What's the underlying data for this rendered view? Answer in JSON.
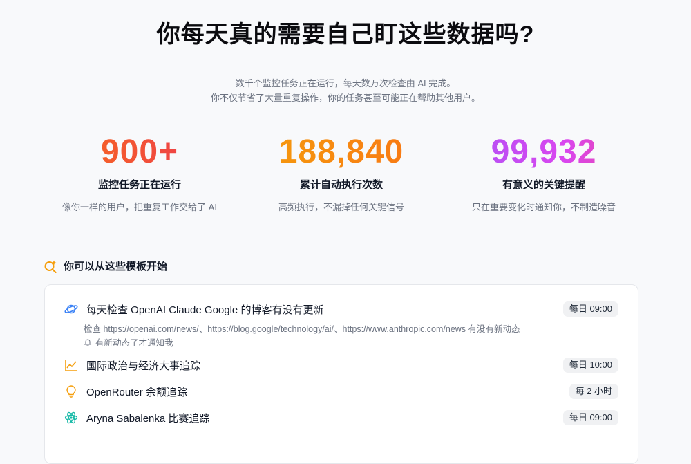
{
  "hero": {
    "title": "你每天真的需要自己盯这些数据吗?",
    "subtitle_line1": "数千个监控任务正在运行，每天数万次检查由 AI 完成。",
    "subtitle_line2": "你不仅节省了大量重复操作，你的任务甚至可能正在帮助其他用户。"
  },
  "stats": [
    {
      "value": "900+",
      "label": "监控任务正在运行",
      "desc": "像你一样的用户，把重复工作交给了 AI"
    },
    {
      "value": "188,840",
      "label": "累计自动执行次数",
      "desc": "高频执行，不漏掉任何关键信号"
    },
    {
      "value": "99,932",
      "label": "有意义的关键提醒",
      "desc": "只在重要变化时通知你，不制造噪音"
    }
  ],
  "templates": {
    "heading": "你可以从这些模板开始",
    "heading_icon": "sparkle-search-icon",
    "items": [
      {
        "title": "每天检查 OpenAI Claude Google 的博客有没有更新",
        "icon": "planet-icon",
        "schedule": "每日 09:00",
        "detail": "检查 https://openai.com/news/、https://blog.google/technology/ai/、https://www.anthropic.com/news 有没有新动态",
        "notify": "有新动态了才通知我",
        "notify_icon": "bell-icon"
      },
      {
        "title": "国际政治与经济大事追踪",
        "icon": "line-chart-icon",
        "schedule": "每日 10:00"
      },
      {
        "title": "OpenRouter 余额追踪",
        "icon": "lightbulb-icon",
        "schedule": "每 2 小时"
      },
      {
        "title": "Aryna Sabalenka 比赛追踪",
        "icon": "atom-icon",
        "schedule": "每日 09:00"
      }
    ]
  },
  "colors": {
    "accent_orange": "#f97316",
    "accent_pink": "#ec4899",
    "accent_purple": "#a855f7",
    "icon_blue": "#3b82f6",
    "icon_yellow": "#f59e0b",
    "icon_teal": "#14b8a6"
  }
}
